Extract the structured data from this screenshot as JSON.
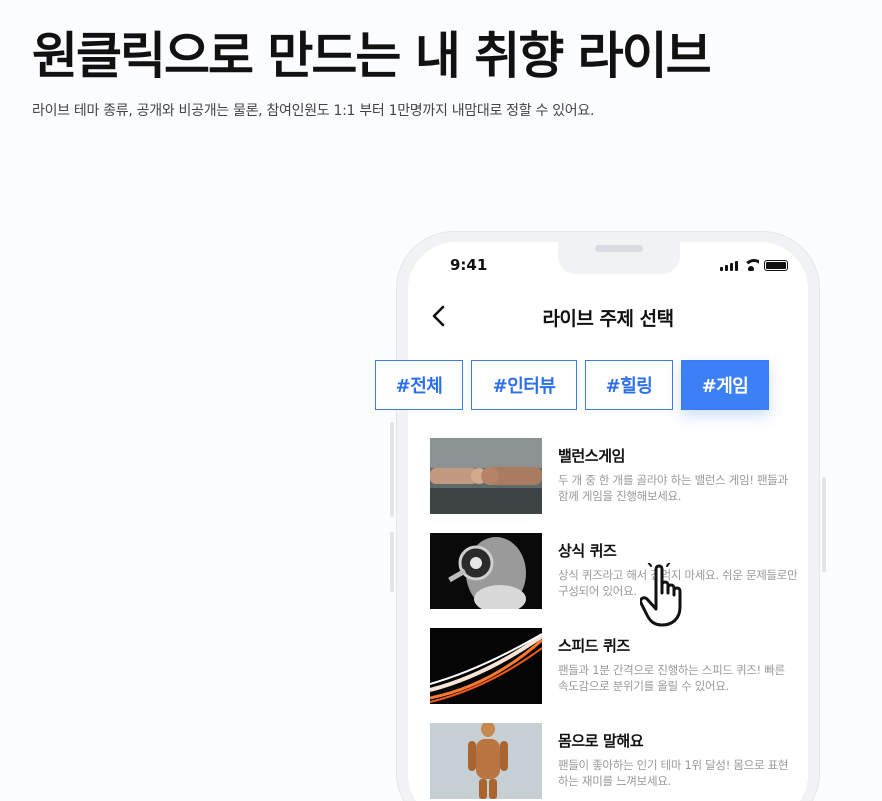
{
  "hero": {
    "title": "원클릭으로 만드는 내 취향 라이브",
    "subtitle": "라이브 테마 종류, 공개와 비공개는 물론, 참여인원도 1:1 부터 1만명까지 내맘대로 정할 수 있어요."
  },
  "phone": {
    "status_time": "9:41",
    "screen_title": "라이브 주제 선택",
    "tags": [
      {
        "label": "#전체",
        "active": false
      },
      {
        "label": "#인터뷰",
        "active": false
      },
      {
        "label": "#힐링",
        "active": false
      },
      {
        "label": "#게임",
        "active": true
      }
    ],
    "items": [
      {
        "title": "밸런스게임",
        "desc": "두 개 중 한 개를 골라야 하는 밸런스 게임! 팬들과 함께 게임을 진행해보세요."
      },
      {
        "title": "상식 퀴즈",
        "desc": "상식 퀴즈라고 해서 겁먹지 마세요. 쉬운 문제들로만 구성되어 있어요."
      },
      {
        "title": "스피드 퀴즈",
        "desc": "팬들과 1분 간격으로 진행하는 스피드 퀴즈! 빠른 속도감으로 분위기를 올릴 수 있어요."
      },
      {
        "title": "몸으로 말해요",
        "desc": "팬들이 좋아하는 인기 테마 1위 달성! 몸으로 표현하는 재미를 느껴보세요."
      }
    ]
  },
  "colors": {
    "accent": "#3c80f6",
    "background": "#fbfcff"
  }
}
